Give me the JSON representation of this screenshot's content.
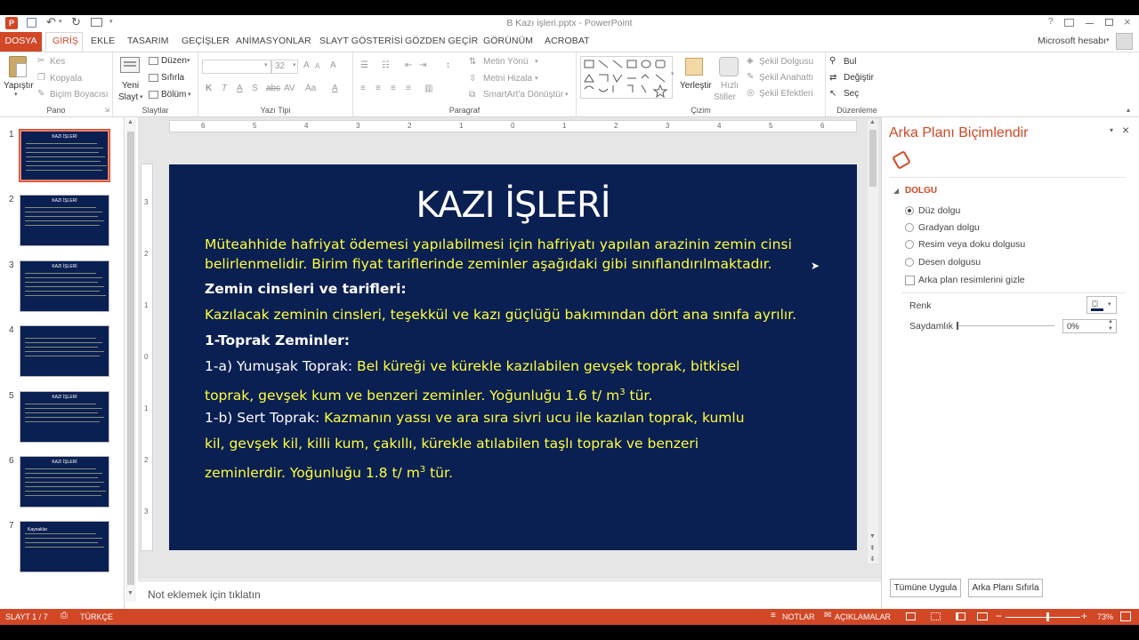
{
  "window": {
    "title": "B Kazı işleri.pptx - PowerPoint",
    "account": "Microsoft hesabı"
  },
  "tabs": [
    "DOSYA",
    "GİRİŞ",
    "EKLE",
    "TASARIM",
    "GEÇİŞLER",
    "ANİMASYONLAR",
    "SLAYT GÖSTERİSİ",
    "GÖZDEN GEÇİR",
    "GÖRÜNÜM",
    "ACROBAT"
  ],
  "ribbon": {
    "pano": {
      "label": "Pano",
      "paste": "Yapıştır",
      "cut": "Kes",
      "copy": "Kopyala",
      "format_painter": "Biçim Boyacısı"
    },
    "slaytlar": {
      "label": "Slaytlar",
      "new_slide_1": "Yeni",
      "new_slide_2": "Slayt",
      "layout": "Düzen",
      "reset": "Sıfırla",
      "section": "Bölüm"
    },
    "yazi_tipi": {
      "label": "Yazı Tipi",
      "font_size": "32"
    },
    "paragraf": {
      "label": "Paragraf",
      "text_direction": "Metin Yönü",
      "align_text": "Metni Hizala",
      "smartart": "SmartArt'a Dönüştür"
    },
    "cizim": {
      "label": "Çizim",
      "arrange": "Yerleştir",
      "quick_styles_1": "Hızlı",
      "quick_styles_2": "Stiller",
      "shape_fill": "Şekil Dolgusu",
      "shape_outline": "Şekil Anahattı",
      "shape_effects": "Şekil Efektleri"
    },
    "duzenleme": {
      "label": "Düzenleme",
      "find": "Bul",
      "replace": "Değiştir",
      "select": "Seç"
    }
  },
  "thumbnails": [
    {
      "num": "1",
      "title": "KAZI İŞLERİ"
    },
    {
      "num": "2",
      "title": "KAZI İŞLERİ"
    },
    {
      "num": "3",
      "title": "KAZI İŞLERİ"
    },
    {
      "num": "4",
      "title": ""
    },
    {
      "num": "5",
      "title": "KAZI İŞLERİ"
    },
    {
      "num": "6",
      "title": "KAZI İŞLERİ"
    },
    {
      "num": "7",
      "title": "Kaynaklar"
    }
  ],
  "ruler": {
    "horizontal": [
      "6",
      "5",
      "4",
      "3",
      "2",
      "1",
      "0",
      "1",
      "2",
      "3",
      "4",
      "5",
      "6"
    ],
    "vertical": [
      "3",
      "2",
      "1",
      "0",
      "1",
      "2",
      "3"
    ]
  },
  "slide": {
    "title": "KAZI İŞLERİ",
    "p1_line1": "Müteahhide hafriyat ödemesi yapılabilmesi için hafriyatı yapılan arazinin zemin cinsi",
    "p1_line2": "belirlenmelidir. Birim fiyat tariflerinde zeminler aşağıdaki gibi sınıflandırılmaktadır.",
    "h1": "Zemin cinsleri ve tarifleri:",
    "p2": "Kazılacak zeminin cinsleri, teşekkül ve kazı güçlüğü bakımından dört ana sınıfa ayrılır.",
    "h2": "1-Toprak Zeminler:",
    "a_label": "1-a) Yumuşak Toprak: ",
    "a_line1": "Bel küreği ve kürekle kazılabilen gevşek toprak, bitkisel",
    "a_line2": "toprak, gevşek kum ve benzeri zeminler. Yoğunluğu 1.6 t/ m",
    "a_sup": "3",
    "a_tail": " tür.",
    "b_label": "1-b) Sert Toprak: ",
    "b_line1": "Kazmanın yassı ve ara sıra sivri ucu ile kazılan toprak, kumlu",
    "b_line2": "kil, gevşek kil, killi kum, çakıllı, kürekle atılabilen taşlı toprak ve benzeri",
    "b_line3": "zeminlerdir. Yoğunluğu 1.8 t/ m",
    "b_sup": "3",
    "b_tail": " tür."
  },
  "notes_placeholder": "Not eklemek için tıklatın",
  "pane": {
    "title": "Arka Planı Biçimlendir",
    "section": "DOLGU",
    "options": [
      "Düz dolgu",
      "Gradyan dolgu",
      "Resim veya doku dolgusu",
      "Desen dolgusu"
    ],
    "selected_option": "Düz dolgu",
    "hide_graphics": "Arka plan resimlerini gizle",
    "color_label": "Renk",
    "transparency_label": "Saydamlık",
    "transparency_value": "0%",
    "apply_all": "Tümüne Uygula",
    "reset_bg": "Arka Planı Sıfırla"
  },
  "status": {
    "slide": "SLAYT 1 / 7",
    "language": "TÜRKÇE",
    "notes": "NOTLAR",
    "comments": "AÇIKLAMALAR",
    "zoom": "73%",
    "zoom_level": 0.55
  },
  "colors": {
    "accent": "#d24726",
    "slide_bg": "#0a1f52",
    "slide_yellow": "#ffff3d"
  }
}
